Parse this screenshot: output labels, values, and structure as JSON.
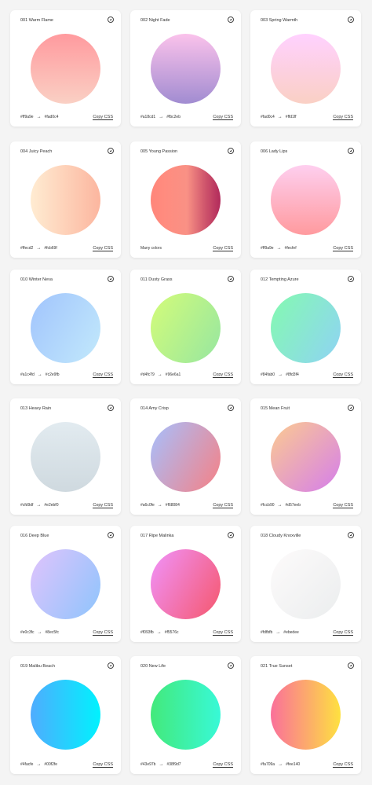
{
  "gradients": [
    {
      "title": "001 Warm Flame",
      "from": "#ff9a9e",
      "to": "#fad0c4",
      "dir": "180deg",
      "colors_text": null,
      "copy": "Copy CSS"
    },
    {
      "title": "002 Night Fade",
      "from": "#a18cd1",
      "to": "#fbc2eb",
      "dir": "0deg",
      "colors_text": null,
      "copy": "Copy CSS"
    },
    {
      "title": "003 Spring Warmth",
      "from": "#fad0c4",
      "to": "#ffd1ff",
      "dir": "0deg",
      "colors_text": null,
      "copy": "Copy CSS"
    },
    {
      "title": "004 Juicy Peach",
      "from": "#ffecd2",
      "to": "#fcb69f",
      "dir": "90deg",
      "colors_text": null,
      "copy": "Copy CSS"
    },
    {
      "title": "005 Young Passion",
      "from": "#ff8177",
      "to": "#b12a5b",
      "dir": "90deg",
      "colors_text": "Many colors",
      "copy": "Copy CSS",
      "multi": [
        "#ff8177 0%",
        "#ff867a 0%",
        "#ff8c7f 21%",
        "#f99185 52%",
        "#cf556c 78%",
        "#b12a5b 100%"
      ]
    },
    {
      "title": "006 Lady Lips",
      "from": "#ff9a9e",
      "to": "#fecfef",
      "dir": "0deg",
      "colors_text": null,
      "copy": "Copy CSS"
    },
    {
      "title": "010 Winter Neva",
      "from": "#a1c4fd",
      "to": "#c2e9fb",
      "dir": "120deg",
      "colors_text": null,
      "copy": "Copy CSS"
    },
    {
      "title": "011 Dusty Grass",
      "from": "#d4fc79",
      "to": "#96e6a1",
      "dir": "120deg",
      "colors_text": null,
      "copy": "Copy CSS"
    },
    {
      "title": "012 Tempting Azure",
      "from": "#84fab0",
      "to": "#8fd3f4",
      "dir": "120deg",
      "colors_text": null,
      "copy": "Copy CSS"
    },
    {
      "title": "013 Heavy Rain",
      "from": "#cfd9df",
      "to": "#e2ebf0",
      "dir": "0deg",
      "colors_text": null,
      "copy": "Copy CSS"
    },
    {
      "title": "014 Amy Crisp",
      "from": "#a6c0fe",
      "to": "#f68084",
      "dir": "120deg",
      "colors_text": null,
      "copy": "Copy CSS"
    },
    {
      "title": "015 Mean Fruit",
      "from": "#fccb90",
      "to": "#d57eeb",
      "dir": "135deg",
      "colors_text": null,
      "copy": "Copy CSS"
    },
    {
      "title": "016 Deep Blue",
      "from": "#e0c3fc",
      "to": "#8ec5fc",
      "dir": "120deg",
      "colors_text": null,
      "copy": "Copy CSS"
    },
    {
      "title": "017 Ripe Malinka",
      "from": "#f093fb",
      "to": "#f5576c",
      "dir": "120deg",
      "colors_text": null,
      "copy": "Copy CSS"
    },
    {
      "title": "018 Cloudy Knoxville",
      "from": "#fdfbfb",
      "to": "#ebedee",
      "dir": "135deg",
      "colors_text": null,
      "copy": "Copy CSS"
    },
    {
      "title": "019 Malibu Beach",
      "from": "#4facfe",
      "to": "#00f2fe",
      "dir": "90deg",
      "colors_text": null,
      "copy": "Copy CSS"
    },
    {
      "title": "020 New Life",
      "from": "#43e97b",
      "to": "#38f9d7",
      "dir": "90deg",
      "colors_text": null,
      "copy": "Copy CSS"
    },
    {
      "title": "021 True Sunset",
      "from": "#fa709a",
      "to": "#fee140",
      "dir": "90deg",
      "colors_text": null,
      "copy": "Copy CSS"
    }
  ]
}
